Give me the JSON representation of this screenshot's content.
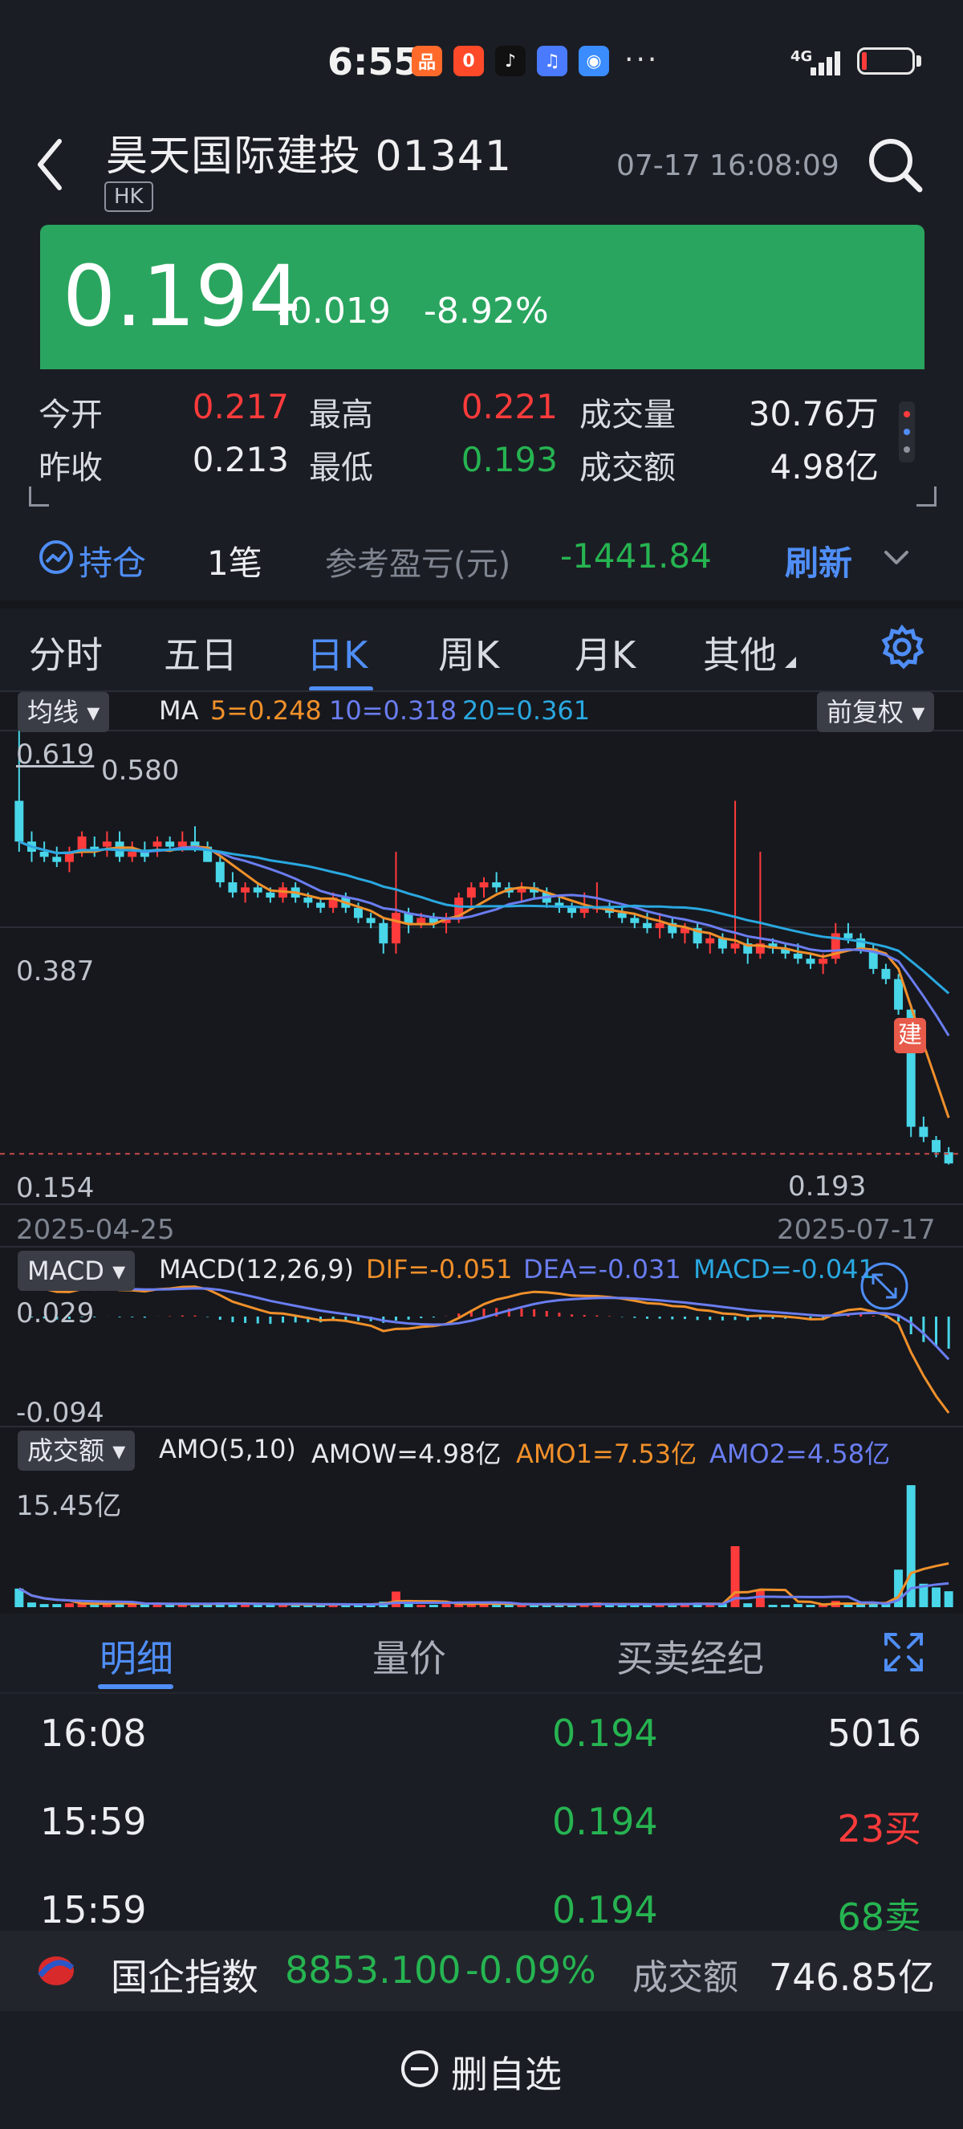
{
  "status_bar": {
    "time": "6:55",
    "network": "4G",
    "apps": [
      {
        "name": "app-icon-1",
        "color": "#ff6a2a",
        "glyph": "品"
      },
      {
        "name": "app-icon-2",
        "color": "#ff4a2a",
        "glyph": "0"
      },
      {
        "name": "tiktok-icon",
        "color": "#111111",
        "glyph": "♪"
      },
      {
        "name": "music-icon",
        "color": "#4a7bff",
        "glyph": "♫"
      },
      {
        "name": "game-icon",
        "color": "#3a8cff",
        "glyph": "◉"
      }
    ],
    "more": "···"
  },
  "header": {
    "title": "昊天国际建投 01341",
    "market": "HK",
    "datetime": "07-17  16:08:09"
  },
  "quote": {
    "price": "0.194",
    "change": "-0.019",
    "change_pct": "-8.92%",
    "color": "#2aa55f"
  },
  "stats": {
    "open_label": "今开",
    "open": "0.217",
    "high_label": "最高",
    "high": "0.221",
    "volume_label": "成交量",
    "volume": "30.76万",
    "prev_label": "昨收",
    "prev": "0.213",
    "low_label": "最低",
    "low": "0.193",
    "amount_label": "成交额",
    "amount": "4.98亿"
  },
  "position": {
    "label": "持仓",
    "count": "1笔",
    "ref_label": "参考盈亏(元)",
    "ref_value": "-1441.84",
    "refresh": "刷新"
  },
  "tabs": [
    "分时",
    "五日",
    "日K",
    "周K",
    "月K",
    "其他"
  ],
  "active_tab": "日K",
  "kline": {
    "ma_select": "均线",
    "ma_label": "MA",
    "ma5": "5=0.248",
    "ma10": "10=0.318",
    "ma20": "20=0.361",
    "adjust": "前复权",
    "price_high": "0.619",
    "price_high2": "0.580",
    "price_mid": "0.387",
    "price_low": "0.154",
    "last_low": "0.193",
    "date_start": "2025-04-25",
    "date_end": "2025-07-17",
    "marker": "建",
    "macd_select": "MACD",
    "macd_label": "MACD(12,26,9)",
    "dif": "DIF=-0.051",
    "dea": "DEA=-0.031",
    "macd": "MACD=-0.041",
    "macd_high": "0.029",
    "macd_low": "-0.094",
    "amo_select": "成交额",
    "amo_label": "AMO(5,10)",
    "amow": "AMOW=4.98亿",
    "amo1": "AMO1=7.53亿",
    "amo2": "AMO2=4.58亿",
    "amo_high": "15.45亿",
    "colors": {
      "up": "#ff3b3b",
      "down": "#48d6e8",
      "ma5": "#f0902a",
      "ma10": "#6a7df0",
      "ma20": "#2aa8e0"
    }
  },
  "chart_data": {
    "type": "candlestick",
    "x_start": "2025-04-25",
    "x_end": "2025-07-17",
    "ylim": [
      0.154,
      0.619
    ],
    "ohlc": [
      [
        0.55,
        0.619,
        0.5,
        0.51
      ],
      [
        0.51,
        0.52,
        0.49,
        0.5
      ],
      [
        0.5,
        0.51,
        0.49,
        0.495
      ],
      [
        0.495,
        0.505,
        0.485,
        0.49
      ],
      [
        0.49,
        0.505,
        0.48,
        0.5
      ],
      [
        0.5,
        0.52,
        0.495,
        0.515
      ],
      [
        0.505,
        0.515,
        0.495,
        0.5
      ],
      [
        0.505,
        0.52,
        0.495,
        0.51
      ],
      [
        0.51,
        0.52,
        0.49,
        0.495
      ],
      [
        0.495,
        0.51,
        0.49,
        0.5
      ],
      [
        0.5,
        0.51,
        0.49,
        0.495
      ],
      [
        0.505,
        0.515,
        0.495,
        0.51
      ],
      [
        0.51,
        0.515,
        0.5,
        0.505
      ],
      [
        0.505,
        0.52,
        0.5,
        0.51
      ],
      [
        0.51,
        0.525,
        0.5,
        0.505
      ],
      [
        0.505,
        0.51,
        0.49,
        0.49
      ],
      [
        0.49,
        0.495,
        0.465,
        0.47
      ],
      [
        0.47,
        0.48,
        0.455,
        0.46
      ],
      [
        0.46,
        0.47,
        0.45,
        0.465
      ],
      [
        0.465,
        0.47,
        0.455,
        0.46
      ],
      [
        0.46,
        0.465,
        0.45,
        0.455
      ],
      [
        0.455,
        0.47,
        0.45,
        0.465
      ],
      [
        0.465,
        0.47,
        0.45,
        0.455
      ],
      [
        0.455,
        0.46,
        0.445,
        0.45
      ],
      [
        0.45,
        0.455,
        0.44,
        0.445
      ],
      [
        0.445,
        0.46,
        0.44,
        0.455
      ],
      [
        0.455,
        0.46,
        0.44,
        0.445
      ],
      [
        0.445,
        0.45,
        0.43,
        0.435
      ],
      [
        0.435,
        0.44,
        0.425,
        0.43
      ],
      [
        0.43,
        0.435,
        0.4,
        0.41
      ],
      [
        0.41,
        0.5,
        0.4,
        0.44
      ],
      [
        0.44,
        0.445,
        0.42,
        0.43
      ],
      [
        0.43,
        0.44,
        0.425,
        0.435
      ],
      [
        0.435,
        0.44,
        0.425,
        0.43
      ],
      [
        0.43,
        0.44,
        0.42,
        0.435
      ],
      [
        0.435,
        0.46,
        0.43,
        0.455
      ],
      [
        0.455,
        0.47,
        0.445,
        0.465
      ],
      [
        0.465,
        0.475,
        0.455,
        0.47
      ],
      [
        0.47,
        0.48,
        0.46,
        0.465
      ],
      [
        0.465,
        0.47,
        0.455,
        0.46
      ],
      [
        0.46,
        0.47,
        0.45,
        0.465
      ],
      [
        0.465,
        0.47,
        0.455,
        0.46
      ],
      [
        0.46,
        0.465,
        0.445,
        0.45
      ],
      [
        0.45,
        0.455,
        0.44,
        0.445
      ],
      [
        0.445,
        0.45,
        0.435,
        0.44
      ],
      [
        0.44,
        0.46,
        0.435,
        0.445
      ],
      [
        0.445,
        0.47,
        0.44,
        0.445
      ],
      [
        0.445,
        0.45,
        0.435,
        0.44
      ],
      [
        0.44,
        0.445,
        0.43,
        0.435
      ],
      [
        0.435,
        0.44,
        0.425,
        0.43
      ],
      [
        0.43,
        0.44,
        0.42,
        0.425
      ],
      [
        0.425,
        0.44,
        0.415,
        0.43
      ],
      [
        0.43,
        0.435,
        0.415,
        0.42
      ],
      [
        0.42,
        0.43,
        0.41,
        0.425
      ],
      [
        0.425,
        0.43,
        0.405,
        0.41
      ],
      [
        0.41,
        0.42,
        0.4,
        0.415
      ],
      [
        0.415,
        0.42,
        0.4,
        0.405
      ],
      [
        0.405,
        0.55,
        0.4,
        0.41
      ],
      [
        0.41,
        0.415,
        0.39,
        0.4
      ],
      [
        0.4,
        0.5,
        0.395,
        0.41
      ],
      [
        0.41,
        0.415,
        0.4,
        0.405
      ],
      [
        0.405,
        0.41,
        0.395,
        0.4
      ],
      [
        0.4,
        0.41,
        0.39,
        0.395
      ],
      [
        0.395,
        0.4,
        0.385,
        0.39
      ],
      [
        0.39,
        0.4,
        0.38,
        0.395
      ],
      [
        0.395,
        0.43,
        0.39,
        0.42
      ],
      [
        0.42,
        0.43,
        0.41,
        0.415
      ],
      [
        0.415,
        0.42,
        0.4,
        0.405
      ],
      [
        0.405,
        0.41,
        0.38,
        0.385
      ],
      [
        0.385,
        0.39,
        0.37,
        0.375
      ],
      [
        0.375,
        0.38,
        0.34,
        0.345
      ],
      [
        0.345,
        0.35,
        0.22,
        0.23
      ],
      [
        0.23,
        0.24,
        0.215,
        0.22
      ],
      [
        0.217,
        0.221,
        0.2,
        0.205
      ],
      [
        0.205,
        0.21,
        0.193,
        0.194
      ]
    ],
    "ma5_label": "5=0.248",
    "ma10_label": "10=0.318",
    "ma20_label": "20=0.361"
  },
  "lower_tabs": [
    "明细",
    "量价",
    "买卖经纪"
  ],
  "trades": [
    {
      "time": "16:08",
      "price": "0.194",
      "vol": "5016",
      "side": "neutral"
    },
    {
      "time": "15:59",
      "price": "0.194",
      "vol": "23买",
      "side": "buy"
    },
    {
      "time": "15:59",
      "price": "0.194",
      "vol": "68卖",
      "side": "sell"
    }
  ],
  "index_bar": {
    "name": "国企指数",
    "value": "8853.100",
    "pct": "-0.09%",
    "amount_label": "成交额",
    "amount": "746.85亿"
  },
  "bottom": {
    "remove_label": "删自选"
  }
}
